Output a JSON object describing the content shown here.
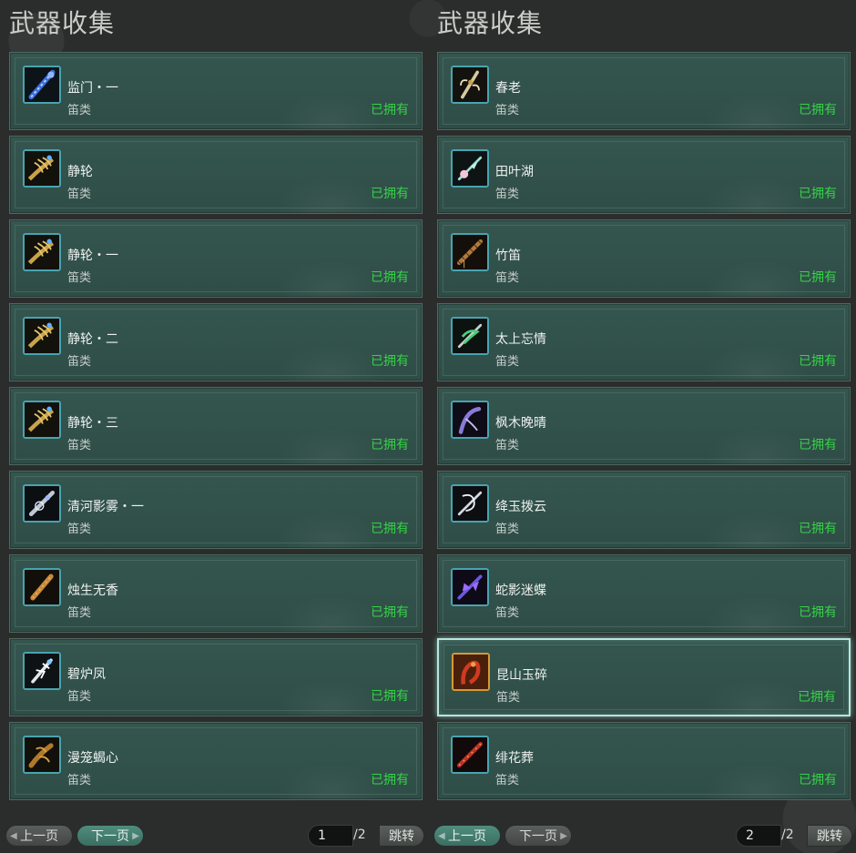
{
  "panels": [
    {
      "title": "武器收集",
      "items": [
        {
          "name": "监门・一",
          "type": "笛类",
          "status": "已拥有",
          "icon": "blue-flute-icon"
        },
        {
          "name": "静轮",
          "type": "笛类",
          "status": "已拥有",
          "icon": "golden-claw-flute-icon"
        },
        {
          "name": "静轮・一",
          "type": "笛类",
          "status": "已拥有",
          "icon": "golden-claw-flute-icon"
        },
        {
          "name": "静轮・二",
          "type": "笛类",
          "status": "已拥有",
          "icon": "golden-claw-flute-icon"
        },
        {
          "name": "静轮・三",
          "type": "笛类",
          "status": "已拥有",
          "icon": "golden-claw-flute-icon"
        },
        {
          "name": "清河影雾・一",
          "type": "笛类",
          "status": "已拥有",
          "icon": "silver-flute-icon"
        },
        {
          "name": "烛生无香",
          "type": "笛类",
          "status": "已拥有",
          "icon": "bronze-flute-icon"
        },
        {
          "name": "碧炉凤",
          "type": "笛类",
          "status": "已拥有",
          "icon": "white-phoenix-flute-icon"
        },
        {
          "name": "漫笼蝎心",
          "type": "笛类",
          "status": "已拥有",
          "icon": "scorpion-flute-icon"
        }
      ],
      "pager": {
        "prev": "上一页",
        "next": "下一页",
        "page": "1",
        "total": "/2",
        "jump": "跳转"
      }
    },
    {
      "title": "武器收集",
      "items": [
        {
          "name": "春老",
          "type": "笛类",
          "status": "已拥有",
          "icon": "antler-flute-icon"
        },
        {
          "name": "田叶湖",
          "type": "笛类",
          "status": "已拥有",
          "icon": "lotus-flute-icon"
        },
        {
          "name": "竹笛",
          "type": "笛类",
          "status": "已拥有",
          "icon": "bamboo-flute-icon"
        },
        {
          "name": "太上忘情",
          "type": "笛类",
          "status": "已拥有",
          "icon": "jade-serpent-flute-icon"
        },
        {
          "name": "枫木晚晴",
          "type": "笛类",
          "status": "已拥有",
          "icon": "violet-flute-icon"
        },
        {
          "name": "绛玉拨云",
          "type": "笛类",
          "status": "已拥有",
          "icon": "silver-dragon-flute-icon"
        },
        {
          "name": "蛇影迷蝶",
          "type": "笛类",
          "status": "已拥有",
          "icon": "butterfly-flute-icon"
        },
        {
          "name": "昆山玉碎",
          "type": "笛类",
          "status": "已拥有",
          "icon": "crimson-dragon-flute-icon",
          "selected": true
        },
        {
          "name": "绯花葬",
          "type": "笛类",
          "status": "已拥有",
          "icon": "red-flute-icon"
        }
      ],
      "pager": {
        "prev": "上一页",
        "next": "下一页",
        "page": "2",
        "total": "/2",
        "jump": "跳转"
      }
    }
  ],
  "colors": {
    "owned": "#35d246",
    "card": "#34564f",
    "icon_border": "#4aa3b0",
    "selected_border": "#b8e6dc"
  }
}
